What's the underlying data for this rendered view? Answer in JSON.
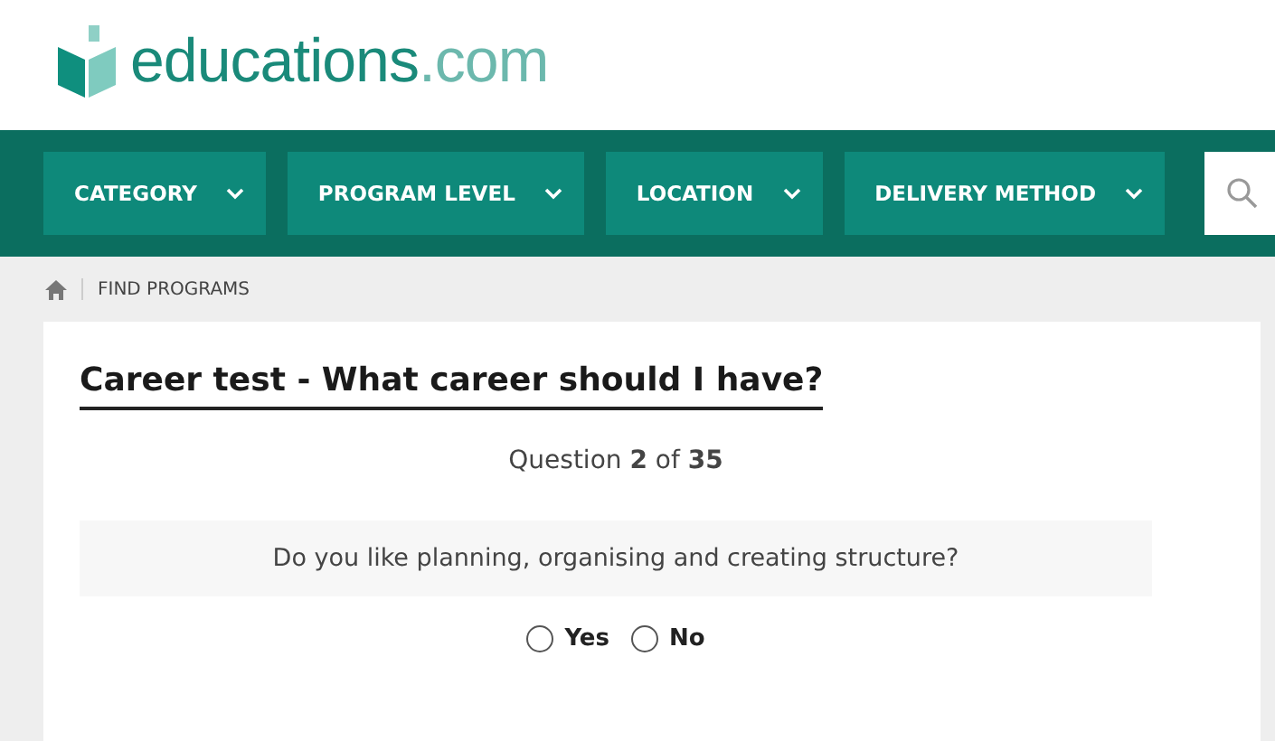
{
  "logo": {
    "name": "educations",
    "suffix": ".com"
  },
  "nav": [
    {
      "label": "CATEGORY"
    },
    {
      "label": "PROGRAM LEVEL"
    },
    {
      "label": "LOCATION"
    },
    {
      "label": "DELIVERY METHOD"
    }
  ],
  "breadcrumb": [
    "FIND PROGRAMS"
  ],
  "title": "Career test - What career should I have?",
  "progress": "Question **2** of **35**",
  "question": "Do you like planning, organising and creating structure?",
  "answers": [
    {
      "label": "Yes",
      "selected": false
    },
    {
      "label": "No",
      "selected": false
    }
  ]
}
